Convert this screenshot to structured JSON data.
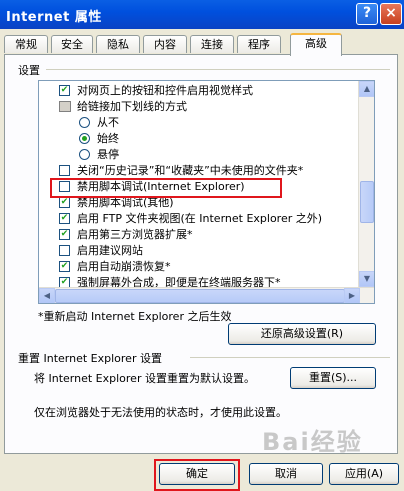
{
  "window": {
    "title": "Internet 属性",
    "help_label": "?",
    "close_label": "×"
  },
  "tabs": [
    {
      "label": "常规"
    },
    {
      "label": "安全"
    },
    {
      "label": "隐私"
    },
    {
      "label": "内容"
    },
    {
      "label": "连接"
    },
    {
      "label": "程序"
    },
    {
      "label": "高级",
      "active": true
    }
  ],
  "settings": {
    "group_label": "设置",
    "items": [
      {
        "type": "checkbox",
        "checked": true,
        "label": "对网页上的按钮和控件启用视觉样式"
      },
      {
        "type": "group",
        "label": "给链接加下划线的方式"
      },
      {
        "type": "radio",
        "checked": false,
        "label": "从不"
      },
      {
        "type": "radio",
        "checked": true,
        "label": "始终"
      },
      {
        "type": "radio",
        "checked": false,
        "label": "悬停"
      },
      {
        "type": "checkbox",
        "checked": false,
        "label": "关闭“历史记录”和“收藏夹”中未使用的文件夹*"
      },
      {
        "type": "checkbox",
        "checked": false,
        "label": "禁用脚本调试(Internet Explorer)"
      },
      {
        "type": "checkbox",
        "checked": true,
        "label": "禁用脚本调试(其他)"
      },
      {
        "type": "checkbox",
        "checked": true,
        "label": "启用 FTP 文件夹视图(在 Internet Explorer 之外)"
      },
      {
        "type": "checkbox",
        "checked": true,
        "label": "启用第三方浏览器扩展*"
      },
      {
        "type": "checkbox",
        "checked": false,
        "label": "启用建议网站"
      },
      {
        "type": "checkbox",
        "checked": true,
        "label": "启用自动崩溃恢复*"
      },
      {
        "type": "checkbox",
        "checked": true,
        "label": "强制屏幕外合成，即便是在终端服务器下*"
      }
    ],
    "restart_note": "*重新启动 Internet Explorer 之后生效",
    "restore_button": "还原高级设置(R)"
  },
  "reset": {
    "group_label": "重置 Internet Explorer 设置",
    "description": "将 Internet Explorer 设置重置为默认设置。",
    "button": "重置(S)...",
    "note": "仅在浏览器处于无法使用的状态时，才使用此设置。"
  },
  "footer": {
    "ok": "确定",
    "cancel": "取消",
    "apply": "应用(A)"
  },
  "watermark": "Bai经验"
}
